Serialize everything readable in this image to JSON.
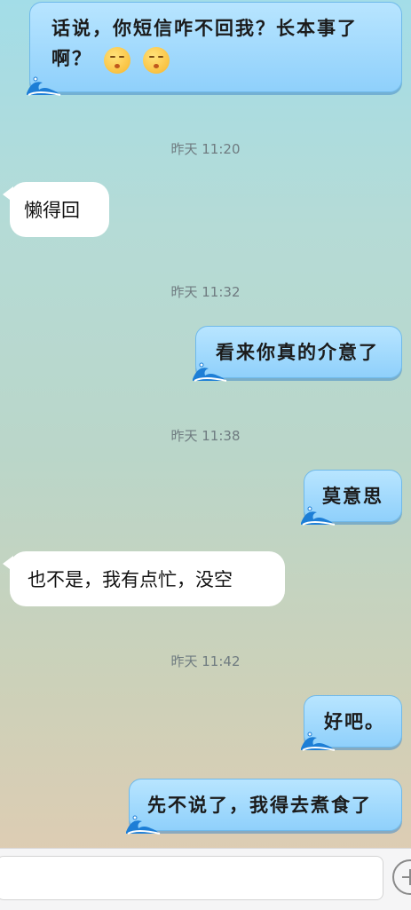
{
  "messages": [
    {
      "side": "right",
      "line1": "话说，你短信咋不回我？长本事了",
      "line2": "啊？",
      "emojis": [
        "hush-emoji",
        "hush-emoji"
      ]
    },
    {
      "timestamp": "昨天 11:20"
    },
    {
      "side": "left",
      "text": "懒得回"
    },
    {
      "timestamp": "昨天 11:32"
    },
    {
      "side": "right",
      "text": "看来你真的介意了"
    },
    {
      "timestamp": "昨天 11:38"
    },
    {
      "side": "right",
      "text": "莫意思"
    },
    {
      "side": "left",
      "text": "也不是，我有点忙，没空"
    },
    {
      "timestamp": "昨天 11:42"
    },
    {
      "side": "right",
      "text": "好吧。"
    },
    {
      "side": "right",
      "text": "先不说了，我得去煮食了"
    }
  ],
  "input": {
    "placeholder": "",
    "add_button_icon": "plus-icon"
  }
}
